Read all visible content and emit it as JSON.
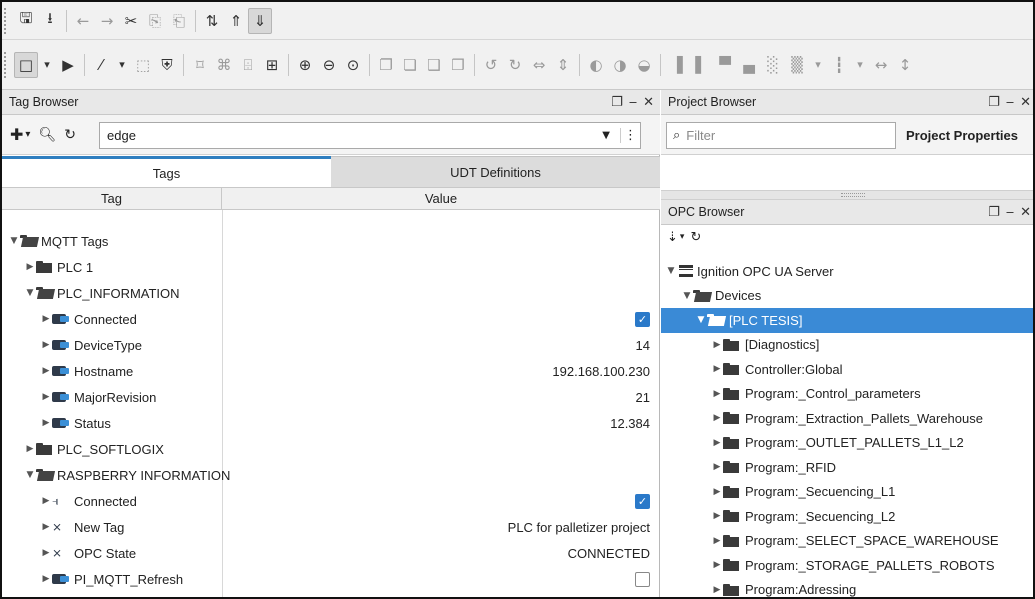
{
  "toolbar_top": {
    "icons": [
      "save-icon",
      "save-all-icon",
      "undo-icon",
      "redo-icon",
      "cut-icon",
      "copy-icon",
      "paste-icon",
      "tag-bindings-icon",
      "tag-up-icon",
      "tag-down-icon"
    ]
  },
  "toolbar_designer": {
    "icons": [
      "selection-tool-icon",
      "preview-icon",
      "wrench-icon",
      "comp-icon",
      "shield-icon",
      "align-icon",
      "group-icon",
      "ungroup-icon",
      "layout-icon",
      "zoom-in-icon",
      "zoom-out-icon",
      "zoom-reset-icon",
      "bring-forward-icon",
      "send-backward-icon",
      "bring-front-icon",
      "send-back-icon",
      "rotate-left-icon",
      "rotate-right-icon",
      "flip-h-icon",
      "flip-v-icon",
      "rotate-icon",
      "align-left-icon",
      "align-right-icon",
      "align-top-icon",
      "align-bottom-icon",
      "distribute-icon",
      "spacing-icon"
    ]
  },
  "tag_browser": {
    "title": "Tag Browser",
    "search_value": "edge",
    "tabs": [
      "Tags",
      "UDT Definitions"
    ],
    "col_tag": "Tag",
    "col_value": "Value",
    "rows": [
      {
        "label": "MQTT Tags",
        "value": ""
      },
      {
        "label": "PLC 1",
        "value": ""
      },
      {
        "label": "PLC_INFORMATION",
        "value": ""
      },
      {
        "label": "Connected",
        "value": "true"
      },
      {
        "label": "DeviceType",
        "value": "14"
      },
      {
        "label": "Hostname",
        "value": "192.168.100.230"
      },
      {
        "label": "MajorRevision",
        "value": "21"
      },
      {
        "label": "Status",
        "value": "12.384"
      },
      {
        "label": "PLC_SOFTLOGIX",
        "value": ""
      },
      {
        "label": "RASPBERRY INFORMATION",
        "value": ""
      },
      {
        "label": "Connected",
        "value": "true"
      },
      {
        "label": "New Tag",
        "value": "PLC for palletizer project"
      },
      {
        "label": "OPC State",
        "value": "CONNECTED"
      },
      {
        "label": "PI_MQTT_Refresh",
        "value": "false"
      }
    ]
  },
  "project_browser": {
    "title": "Project Browser",
    "filter_placeholder": "Filter",
    "project_properties": "Project Properties"
  },
  "opc_browser": {
    "title": "OPC Browser",
    "rows": [
      {
        "label": "Ignition OPC UA Server"
      },
      {
        "label": "Devices"
      },
      {
        "label": "[PLC TESIS]"
      },
      {
        "label": "[Diagnostics]"
      },
      {
        "label": "Controller:Global"
      },
      {
        "label": "Program:_Control_parameters"
      },
      {
        "label": "Program:_Extraction_Pallets_Warehouse"
      },
      {
        "label": "Program:_OUTLET_PALLETS_L1_L2"
      },
      {
        "label": "Program:_RFID"
      },
      {
        "label": "Program:_Secuencing_L1"
      },
      {
        "label": "Program:_Secuencing_L2"
      },
      {
        "label": "Program:_SELECT_SPACE_WAREHOUSE"
      },
      {
        "label": "Program:_STORAGE_PALLETS_ROBOTS"
      },
      {
        "label": "Program:Adressing"
      }
    ]
  },
  "colors": {
    "accent": "#2f7fc0",
    "selection": "#3a8ad6",
    "checkbox": "#2a79c9"
  }
}
